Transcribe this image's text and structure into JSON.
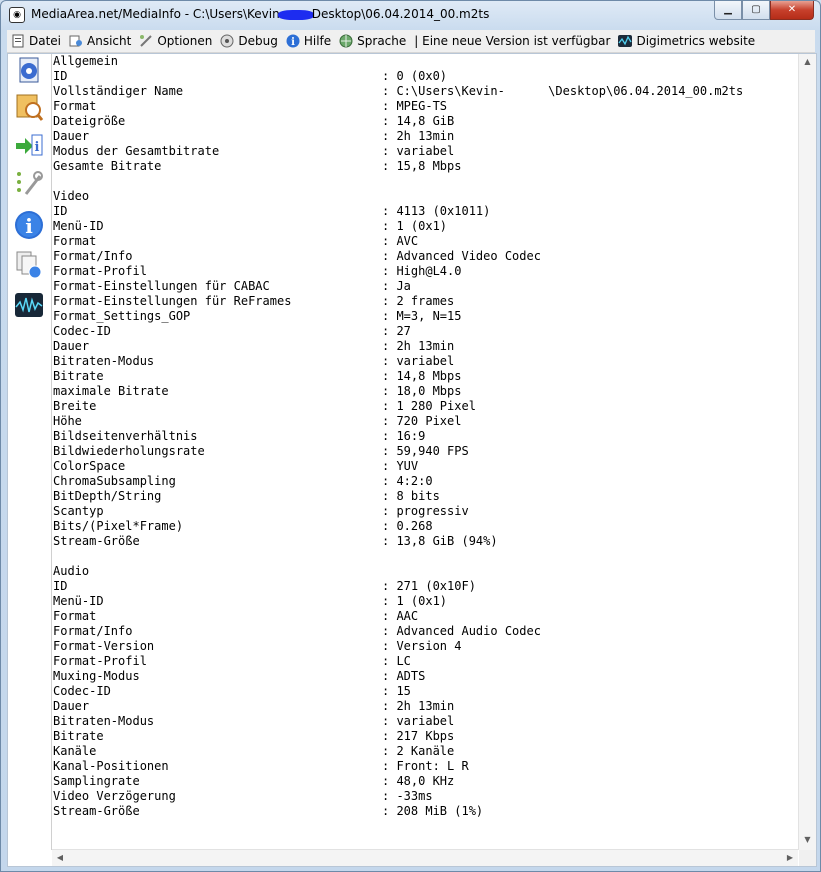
{
  "window": {
    "title_prefix": "MediaArea.net/MediaInfo - C:\\Users\\Kevin",
    "title_suffix": "Desktop\\06.04.2014_00.m2ts",
    "minimize": "▁",
    "maximize": "▢",
    "close": "✕"
  },
  "menu": {
    "datei": "Datei",
    "ansicht": "Ansicht",
    "optionen": "Optionen",
    "debug": "Debug",
    "hilfe": "Hilfe",
    "sprache": "Sprache",
    "update": "| Eine neue Version ist verfügbar",
    "digimetrics": "Digimetrics website"
  },
  "icons": {
    "sidebar": [
      "basic-view-icon",
      "sheet-view-icon",
      "tree-info-icon",
      "text-view-icon",
      "info-icon",
      "html-view-icon",
      "waveform-icon"
    ]
  },
  "report": {
    "general": {
      "header": "Allgemein",
      "rows": [
        [
          "ID",
          ": 0 (0x0)"
        ],
        [
          "Vollständiger Name",
          ": C:\\Users\\Kevin-      \\Desktop\\06.04.2014_00.m2ts"
        ],
        [
          "Format",
          ": MPEG-TS"
        ],
        [
          "Dateigröße",
          ": 14,8 GiB"
        ],
        [
          "Dauer",
          ": 2h 13min"
        ],
        [
          "Modus der Gesamtbitrate",
          ": variabel"
        ],
        [
          "Gesamte Bitrate",
          ": 15,8 Mbps"
        ]
      ]
    },
    "video": {
      "header": "Video",
      "rows": [
        [
          "ID",
          ": 4113 (0x1011)"
        ],
        [
          "Menü-ID",
          ": 1 (0x1)"
        ],
        [
          "Format",
          ": AVC"
        ],
        [
          "Format/Info",
          ": Advanced Video Codec"
        ],
        [
          "Format-Profil",
          ": High@L4.0"
        ],
        [
          "Format-Einstellungen für CABAC",
          ": Ja"
        ],
        [
          "Format-Einstellungen für ReFrames",
          ": 2 frames"
        ],
        [
          "Format_Settings_GOP",
          ": M=3, N=15"
        ],
        [
          "Codec-ID",
          ": 27"
        ],
        [
          "Dauer",
          ": 2h 13min"
        ],
        [
          "Bitraten-Modus",
          ": variabel"
        ],
        [
          "Bitrate",
          ": 14,8 Mbps"
        ],
        [
          "maximale Bitrate",
          ": 18,0 Mbps"
        ],
        [
          "Breite",
          ": 1 280 Pixel"
        ],
        [
          "Höhe",
          ": 720 Pixel"
        ],
        [
          "Bildseitenverhältnis",
          ": 16:9"
        ],
        [
          "Bildwiederholungsrate",
          ": 59,940 FPS"
        ],
        [
          "ColorSpace",
          ": YUV"
        ],
        [
          "ChromaSubsampling",
          ": 4:2:0"
        ],
        [
          "BitDepth/String",
          ": 8 bits"
        ],
        [
          "Scantyp",
          ": progressiv"
        ],
        [
          "Bits/(Pixel*Frame)",
          ": 0.268"
        ],
        [
          "Stream-Größe",
          ": 13,8 GiB (94%)"
        ]
      ]
    },
    "audio": {
      "header": "Audio",
      "rows": [
        [
          "ID",
          ": 271 (0x10F)"
        ],
        [
          "Menü-ID",
          ": 1 (0x1)"
        ],
        [
          "Format",
          ": AAC"
        ],
        [
          "Format/Info",
          ": Advanced Audio Codec"
        ],
        [
          "Format-Version",
          ": Version 4"
        ],
        [
          "Format-Profil",
          ": LC"
        ],
        [
          "Muxing-Modus",
          ": ADTS"
        ],
        [
          "Codec-ID",
          ": 15"
        ],
        [
          "Dauer",
          ": 2h 13min"
        ],
        [
          "Bitraten-Modus",
          ": variabel"
        ],
        [
          "Bitrate",
          ": 217 Kbps"
        ],
        [
          "Kanäle",
          ": 2 Kanäle"
        ],
        [
          "Kanal-Positionen",
          ": Front: L R"
        ],
        [
          "Samplingrate",
          ": 48,0 KHz"
        ],
        [
          "Video Verzögerung",
          ": -33ms"
        ],
        [
          "Stream-Größe",
          ": 208 MiB (1%)"
        ]
      ]
    }
  }
}
